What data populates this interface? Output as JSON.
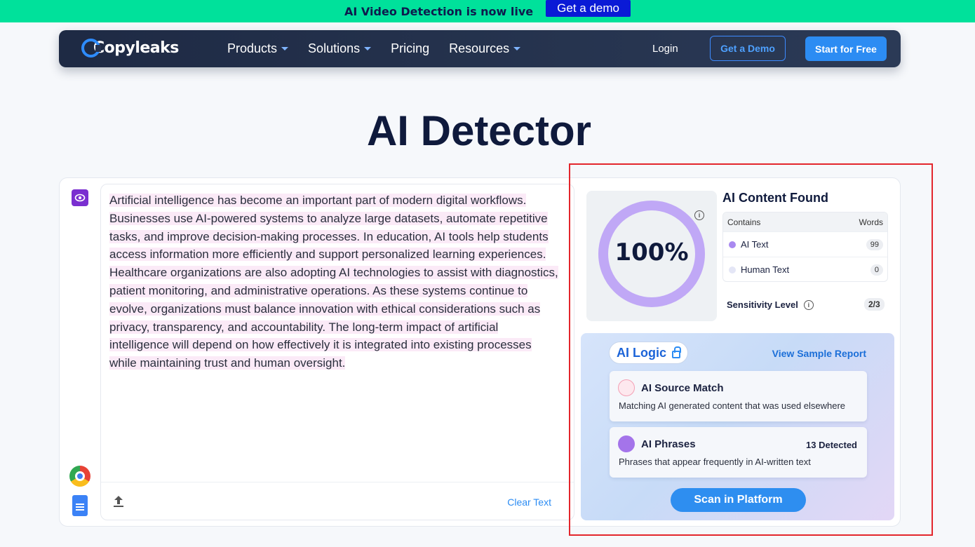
{
  "banner": {
    "text": "AI Video Detection is now live",
    "button": "Get a demo"
  },
  "nav": {
    "logo": "Copyleaks",
    "links": [
      "Products",
      "Solutions",
      "Pricing",
      "Resources"
    ],
    "login": "Login",
    "demo": "Get a Demo",
    "free": "Start for Free"
  },
  "page_title": "AI Detector",
  "editor": {
    "text": "Artificial intelligence has become an important part of modern digital workflows. Businesses use AI-powered systems to analyze large datasets, automate repetitive tasks, and improve decision-making processes. In education, AI tools help students access information more efficiently and support personalized learning experiences. Healthcare organizations are also adopting AI technologies to assist with diagnostics, patient monitoring, and administrative operations. As these systems continue to evolve, organizations must balance innovation with ethical considerations such as privacy, transparency, and accountability. The long-term impact of artificial intelligence will depend on how effectively it is integrated into existing processes while maintaining trust and human oversight.",
    "clear": "Clear Text"
  },
  "results": {
    "score": "100%",
    "score_fraction": 1.0,
    "title": "AI Content Found",
    "table_head": {
      "contains": "Contains",
      "words": "Words"
    },
    "rows": [
      {
        "label": "AI Text",
        "count": "99",
        "color": "#a989f0"
      },
      {
        "label": "Human Text",
        "count": "0",
        "color": "#e4e6f6"
      }
    ],
    "sensitivity_label": "Sensitivity Level",
    "sensitivity_value": "2/3"
  },
  "ai_logic": {
    "label": "AI Logic",
    "sample": "View Sample Report",
    "source_match": {
      "title": "AI Source Match",
      "desc": "Matching AI generated content that was used elsewhere"
    },
    "phrases": {
      "title": "AI Phrases",
      "count": "13 Detected",
      "desc": "Phrases that appear frequently in AI-written text"
    },
    "scan": "Scan in Platform"
  },
  "colors": {
    "accent": "#2c8cf3",
    "banner": "#00e19b",
    "highlight": "#e3262c",
    "donut": "#c0a8f6"
  }
}
